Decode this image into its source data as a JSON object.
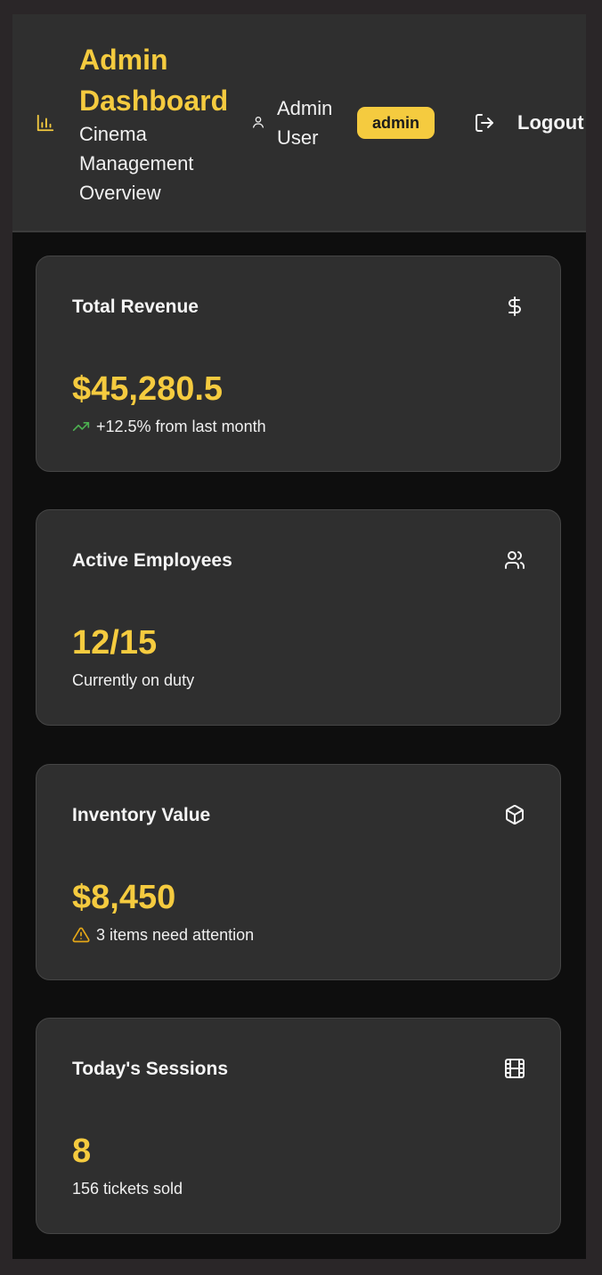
{
  "header": {
    "title": "Admin Dashboard",
    "subtitle": "Cinema Management Overview",
    "header_icon": "bar-chart-icon",
    "user": {
      "icon": "user-icon",
      "name": "Admin User",
      "role": "admin"
    },
    "logout": {
      "icon": "logout-icon",
      "label": "Logout"
    }
  },
  "cards": [
    {
      "title": "Total Revenue",
      "icon": "dollar-icon",
      "value": "$45,280.5",
      "note": "+12.5% from last month",
      "note_icon": "trending-up-icon"
    },
    {
      "title": "Active Employees",
      "icon": "users-icon",
      "value": "12/15",
      "note": "Currently on duty"
    },
    {
      "title": "Inventory Value",
      "icon": "package-icon",
      "value": "$8,450",
      "note": "3 items need attention",
      "note_icon": "warning-icon"
    },
    {
      "title": "Today's Sessions",
      "icon": "film-icon",
      "value": "8",
      "note": "156 tickets sold"
    }
  ],
  "colors": {
    "accent": "#f5cb3f",
    "background": "#0e0e0e",
    "panel": "#2f2f2f",
    "trend_up": "#4caf50",
    "warning": "#e6a817"
  }
}
